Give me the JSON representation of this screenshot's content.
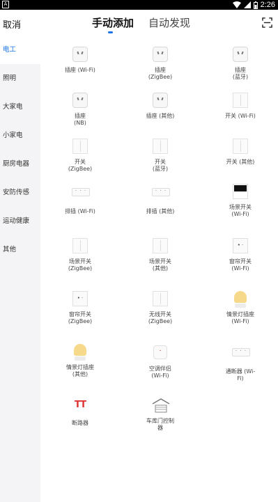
{
  "statusbar": {
    "time": "2:26",
    "notification_icon": "A"
  },
  "header": {
    "cancel_label": "取消",
    "tabs": [
      {
        "label": "手动添加",
        "active": true
      },
      {
        "label": "自动发现",
        "active": false
      }
    ],
    "scan_icon": "scan-icon"
  },
  "sidebar": {
    "items": [
      {
        "label": "电工",
        "active": true
      },
      {
        "label": "照明",
        "active": false
      },
      {
        "label": "大家电",
        "active": false
      },
      {
        "label": "小家电",
        "active": false
      },
      {
        "label": "厨房电器",
        "active": false
      },
      {
        "label": "安防传感",
        "active": false
      },
      {
        "label": "运动健康",
        "active": false
      },
      {
        "label": "其他",
        "active": false
      }
    ]
  },
  "devices": [
    {
      "label": "插座 (Wi-Fi)",
      "icon": "socket-icon"
    },
    {
      "label": "插座\n(ZigBee)",
      "icon": "socket-icon"
    },
    {
      "label": "插座\n(蓝牙)",
      "icon": "socket-icon"
    },
    {
      "label": "插座\n(NB)",
      "icon": "socket-icon"
    },
    {
      "label": "插座 (其他)",
      "icon": "socket-icon"
    },
    {
      "label": "开关 (Wi-Fi)",
      "icon": "switch-icon"
    },
    {
      "label": "开关\n(ZigBee)",
      "icon": "switch-icon"
    },
    {
      "label": "开关\n(蓝牙)",
      "icon": "switch-icon"
    },
    {
      "label": "开关 (其他)",
      "icon": "switch-icon"
    },
    {
      "label": "排插 (Wi-Fi)",
      "icon": "power-strip-icon"
    },
    {
      "label": "排插 (其他)",
      "icon": "power-strip-icon"
    },
    {
      "label": "场景开关\n(Wi-Fi)",
      "icon": "scene-switch-icon"
    },
    {
      "label": "场景开关\n(ZigBee)",
      "icon": "switch-icon"
    },
    {
      "label": "场景开关\n(其他)",
      "icon": "switch-icon"
    },
    {
      "label": "窗帘开关\n(Wi-Fi)",
      "icon": "curtain-switch-icon"
    },
    {
      "label": "窗帘开关\n(ZigBee)",
      "icon": "curtain-switch-icon"
    },
    {
      "label": "无线开关\n(ZigBee)",
      "icon": "switch-icon"
    },
    {
      "label": "情景灯插座\n(Wi-Fi)",
      "icon": "lamp-socket-icon"
    },
    {
      "label": "情景灯插座\n(其他)",
      "icon": "lamp-socket-icon"
    },
    {
      "label": "空调伴侣\n(Wi-Fi)",
      "icon": "ac-companion-icon"
    },
    {
      "label": "通断器 (Wi-\nFi)",
      "icon": "on-off-controller-icon"
    },
    {
      "label": "断路器",
      "icon": "circuit-breaker-icon"
    },
    {
      "label": "车库门控制\n器",
      "icon": "garage-door-icon"
    }
  ],
  "colors": {
    "accent": "#1a73e8",
    "sidebar_bg": "#f4f4f6",
    "lamp": "#f7d98b",
    "breaker": "#dd3333"
  }
}
